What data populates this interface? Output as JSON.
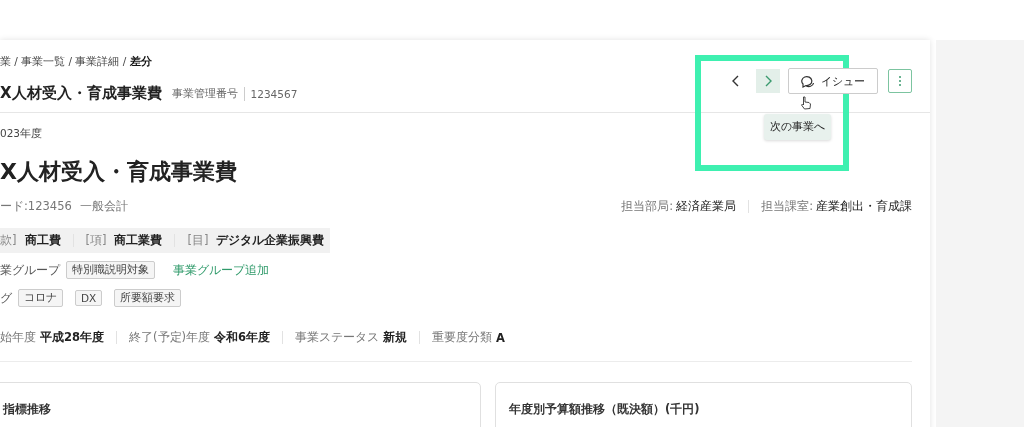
{
  "breadcrumb": "業 / 事業一覧 / 事業詳細 / **差分**",
  "header": {
    "title": "X人材受入・育成事業費",
    "id_label": "事業管理番号",
    "id_value": "1234567",
    "next_hovered": true,
    "issue_button": "イシュー",
    "tooltip": "次の事業へ"
  },
  "fiscal_year": "023年度",
  "title": "X人材受入・育成事業費",
  "code": "ード:123456",
  "account": "一般会計",
  "departments": [
    {
      "label": "担当部局:",
      "value": "経済産業局"
    },
    {
      "label": "担当課室:",
      "value": "産業創出・育成課"
    }
  ],
  "budget_items": [
    {
      "label": "款]",
      "value": "商工費"
    },
    {
      "label": "[項]",
      "value": "商工業費"
    },
    {
      "label": "[目]",
      "value": "デジタル企業振興費"
    }
  ],
  "group": {
    "label": "業グループ",
    "tags": [
      "特別職説明対象"
    ],
    "add_link": "事業グループ追加"
  },
  "tag_row": {
    "label": "グ",
    "tags": [
      "コロナ",
      "DX",
      "所要額要求"
    ]
  },
  "info": [
    {
      "label": "始年度",
      "value": "平成28年度"
    },
    {
      "label": "終了(予定)年度",
      "value": "令和6年度"
    },
    {
      "label": "事業ステータス",
      "value": "新規"
    },
    {
      "label": "重要度分類",
      "value": "A"
    }
  ],
  "cards": [
    {
      "title": "指標推移"
    },
    {
      "title": "年度別予算額推移（既決額）(千円)"
    }
  ]
}
